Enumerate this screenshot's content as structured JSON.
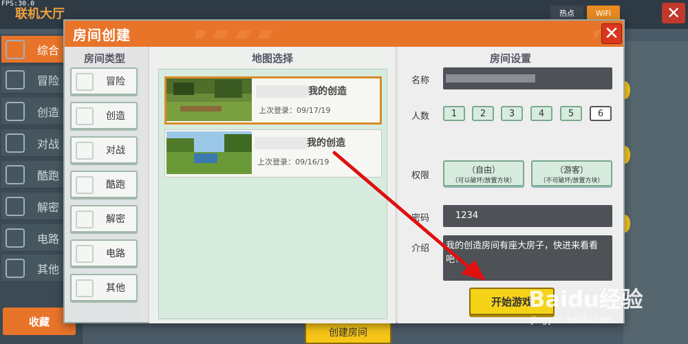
{
  "fps": "FPS:30.0",
  "lobby": {
    "title": "联机大厅",
    "tabs": [
      "热点",
      "WiFi"
    ],
    "close_glyph": "✕",
    "sidebar": [
      "综合",
      "冒险",
      "创造",
      "对战",
      "酷跑",
      "解密",
      "电路",
      "其他"
    ],
    "favorites": "收藏",
    "create_room": "创建房间"
  },
  "dialog": {
    "title": "房间创建",
    "close_glyph": "✕",
    "room_types": {
      "header": "房间类型",
      "items": [
        "冒险",
        "创造",
        "对战",
        "酷跑",
        "解密",
        "电路",
        "其他"
      ]
    },
    "map_select": {
      "header": "地图选择",
      "maps": [
        {
          "name": "我的创造",
          "date": "上次登录：09/17/19",
          "selected": true
        },
        {
          "name": "我的创造",
          "date": "上次登录：09/16/19",
          "selected": false
        }
      ]
    },
    "settings": {
      "header": "房间设置",
      "name_label": "名称",
      "count_label": "人数",
      "counts": [
        "1",
        "2",
        "3",
        "4",
        "5",
        "6"
      ],
      "selected_count": "6",
      "perm_label": "权限",
      "perms": [
        {
          "title": "（自由）",
          "desc": "（可以破坏/放置方块）"
        },
        {
          "title": "（游客）",
          "desc": "（不可破坏/放置方块）"
        }
      ],
      "password_label": "密码",
      "password_value": "1234",
      "intro_label": "介绍",
      "intro_value": "我的创造房间有座大房子，快进来看看吧！",
      "start_button": "开始游戏"
    }
  },
  "watermark": {
    "logo": "Baidu经验",
    "url": "jingyan.baidu.com"
  },
  "colors": {
    "accent_orange": "#e8742a",
    "start_yellow": "#f5d318",
    "arrow_red": "#e01010",
    "panel_green": "#d7ecdf"
  }
}
